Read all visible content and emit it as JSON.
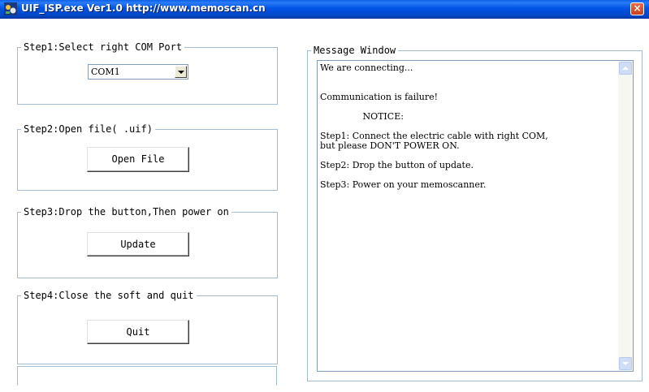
{
  "window": {
    "title": "UIF_ISP.exe  Ver1.0  http://www.memoscan.cn",
    "close_glyph": "×",
    "app_icon": "app-logo-icon"
  },
  "steps": [
    {
      "legend": "Step1:Select right COM Port"
    },
    {
      "legend": "Step2:Open file( .uif)",
      "button_label": "Open File"
    },
    {
      "legend": "Step3:Drop the button,Then power on",
      "button_label": "Update"
    },
    {
      "legend": "Step4:Close the soft and quit",
      "button_label": "Quit"
    }
  ],
  "com_port": {
    "selected": "COM1"
  },
  "message_window": {
    "legend": "Message Window",
    "lines": [
      "We are connecting...",
      "",
      "",
      "Communication is failure!",
      "",
      "               NOTICE:",
      "",
      "Step1: Connect the electric cable with right COM,",
      "but please DON'T POWER ON.",
      "",
      "Step2: Drop the button of update.",
      "",
      "Step3: Power on your memoscanner."
    ]
  },
  "colors": {
    "titlebar": "#0055e5",
    "group_border": "#a6bcd0",
    "client_bg": "#ffffff"
  }
}
